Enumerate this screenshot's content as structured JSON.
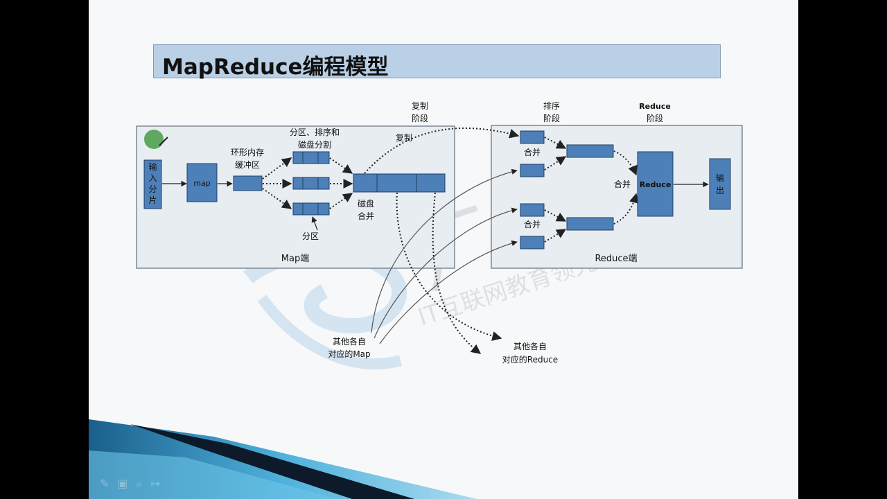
{
  "slide": {
    "title": "MapReduce编程模型"
  },
  "diagram": {
    "map_side": {
      "label": "Map端",
      "input_line1": "输",
      "input_line2": "入",
      "input_line3": "分",
      "input_line4": "片",
      "map_box": "map",
      "ring_buffer_line1": "环形内存",
      "ring_buffer_line2": "缓冲区",
      "partition_sort_line1": "分区、排序和",
      "partition_sort_line2": "磁盘分割",
      "partition": "分区",
      "disk_merge_line1": "磁盘",
      "disk_merge_line2": "合并"
    },
    "copy_stage_line1": "复制",
    "copy_stage_line2": "阶段",
    "copy": "复制",
    "reduce_side": {
      "label": "Reduce端",
      "sort_stage_line1": "排序",
      "sort_stage_line2": "阶段",
      "reduce_stage_line1": "Reduce",
      "reduce_stage_line2": "阶段",
      "merge_top": "合并",
      "merge_bottom": "合并",
      "merge_mid": "合并",
      "reduce_box": "Reduce",
      "output_line1": "输",
      "output_line2": "出"
    },
    "other_map_line1": "其他各自",
    "other_map_line2": "对应的Map",
    "other_reduce_line1": "其他各自",
    "other_reduce_line2": "对应的Reduce"
  },
  "watermark": {
    "text": "IT互联网教育领先品牌"
  },
  "colors": {
    "box_fill": "#4d80b8",
    "box_stroke": "#1e3e66",
    "panel_fill": "#e8edf2",
    "title_bg": "#b9d0e6",
    "pointer_green": "#5fa85f"
  },
  "toolbar": {
    "pen": "✎",
    "screen": "▣",
    "search": "⌕",
    "arrow": "↦"
  }
}
